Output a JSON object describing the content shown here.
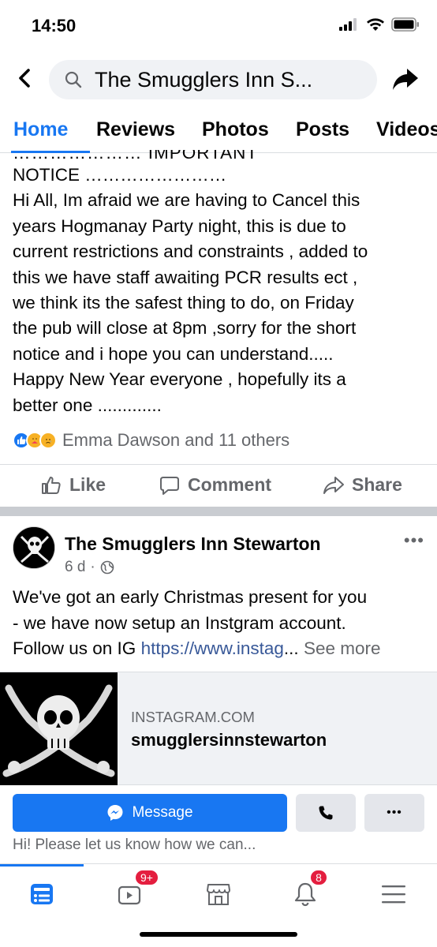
{
  "status_bar": {
    "time": "14:50"
  },
  "header": {
    "search_text": "The Smugglers Inn  S..."
  },
  "tabs": [
    {
      "label": "Home",
      "active": true
    },
    {
      "label": "Reviews"
    },
    {
      "label": "Photos"
    },
    {
      "label": "Posts"
    },
    {
      "label": "Videos"
    }
  ],
  "post1": {
    "cut_line": "…………………          IMPORTANT",
    "lines": [
      "NOTICE        ……………………",
      "Hi All, Im afraid we are having to Cancel this",
      "years Hogmanay Party night, this is due to",
      "current restrictions and constraints , added to",
      "this we have staff awaiting PCR results ect ,",
      "we think its the safest thing to do, on Friday",
      "the pub will close at 8pm ,sorry for the short",
      "notice and i hope you can understand.....",
      "Happy New Year everyone , hopefully its a",
      "better one ............."
    ],
    "reactions_text": "Emma Dawson and 11 others"
  },
  "actions": {
    "like": "Like",
    "comment": "Comment",
    "share": "Share"
  },
  "post2": {
    "page_name": "The Smugglers Inn  Stewarton",
    "time": "6 d",
    "text_lines": [
      "We've got an early Christmas present for you",
      "- we have now setup an Instgram account."
    ],
    "follow_prefix": "Follow us on IG ",
    "link": "https://www.instag",
    "ellipsis": "...",
    "see_more": " See more",
    "preview": {
      "domain": "INSTAGRAM.COM",
      "title": "smugglersinnstewarton"
    }
  },
  "message_bar": {
    "message_label": "Message",
    "hint": "Hi! Please let us know how we can..."
  },
  "bottom_nav": {
    "watch_badge": "9+",
    "notifications_badge": "8"
  },
  "colors": {
    "accent": "#1877f2",
    "badge": "#e41e3f",
    "secondary_text": "#65676b"
  }
}
